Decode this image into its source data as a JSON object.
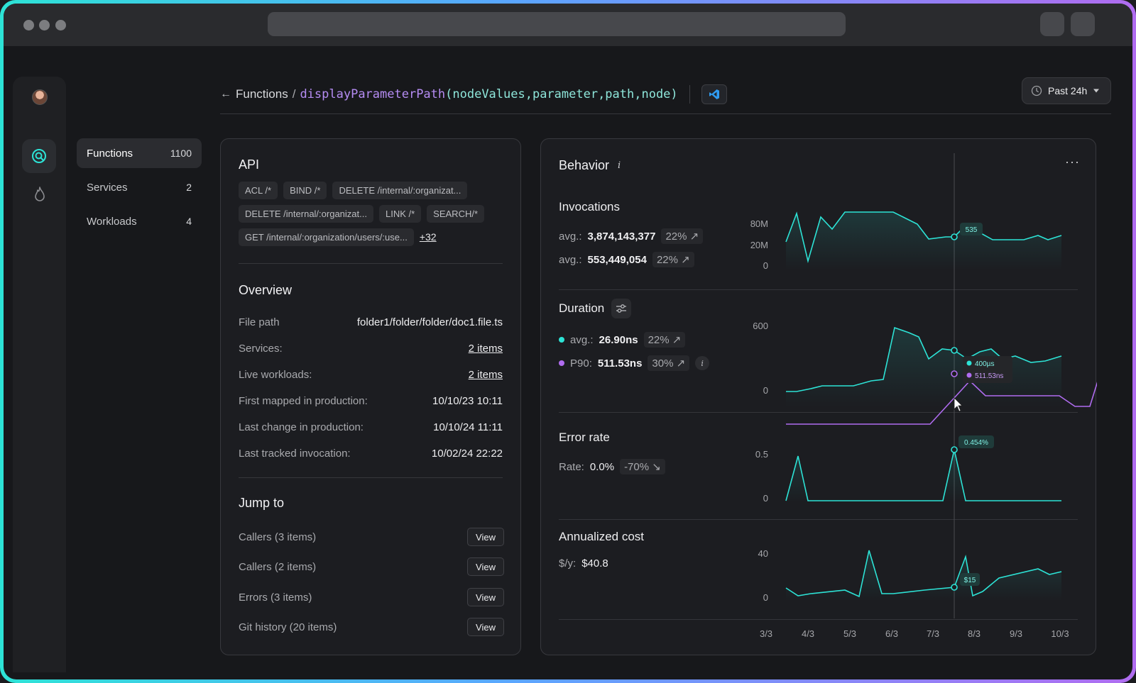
{
  "breadcrumb": {
    "back": "←",
    "root": "Functions",
    "sep": "/",
    "fn_name": "displayParameterPath",
    "fn_args": "(nodeValues,parameter,path,node)"
  },
  "time_range": "Past 24h",
  "colors": {
    "accent_teal": "#2de3d6",
    "accent_purple": "#b06cf0"
  },
  "sidebar": {
    "items": [
      {
        "label": "Functions",
        "count": "1100"
      },
      {
        "label": "Services",
        "count": "2"
      },
      {
        "label": "Workloads",
        "count": "4"
      }
    ]
  },
  "api": {
    "title": "API",
    "chips": [
      "ACL /*",
      "BIND /*",
      "DELETE /internal/:organizat...",
      "DELETE /internal/:organizat...",
      "LINK /*",
      "SEARCH/*",
      "GET /internal/:organization/users/:use..."
    ],
    "more": "+32"
  },
  "overview": {
    "title": "Overview",
    "rows": [
      {
        "k": "File path",
        "v": "folder1/folder/folder/doc1.file.ts"
      },
      {
        "k": "Services:",
        "v": "2 items"
      },
      {
        "k": "Live workloads:",
        "v": "2 items"
      },
      {
        "k": "First mapped in production:",
        "v": "10/10/23 10:11"
      },
      {
        "k": "Last change in production:",
        "v": "10/10/24 11:11"
      },
      {
        "k": "Last tracked invocation:",
        "v": "10/02/24 22:22"
      }
    ]
  },
  "jump": {
    "title": "Jump to",
    "view_label": "View",
    "items": [
      "Callers (3 items)",
      "Callers (2 items)",
      "Errors (3 items)",
      "Git history (20 items)"
    ]
  },
  "behavior": {
    "title": "Behavior",
    "info": "i",
    "menu": "···",
    "x_labels": [
      "3/3",
      "4/3",
      "5/3",
      "6/3",
      "7/3",
      "8/3",
      "9/3",
      "10/3"
    ],
    "invocations": {
      "title": "Invocations",
      "rows": [
        {
          "label": "avg.:",
          "value": "3,874,143,377",
          "delta": "22% ↗"
        },
        {
          "label": "avg.:",
          "value": "553,449,054",
          "delta": "22% ↗"
        }
      ],
      "y_ticks": [
        "80M",
        "20M",
        "0"
      ],
      "tooltip": "535"
    },
    "duration": {
      "title": "Duration",
      "rows": [
        {
          "label": "avg.:",
          "value": "26.90ns",
          "delta": "22% ↗"
        },
        {
          "label": "P90:",
          "value": "511.53ns",
          "delta": "30% ↗"
        }
      ],
      "info": "i",
      "y_ticks": [
        "600",
        "0"
      ],
      "tooltip_a": "400µs",
      "tooltip_b": "511.53ns"
    },
    "error_rate": {
      "title": "Error rate",
      "label": "Rate:",
      "value": "0.0%",
      "delta": "-70% ↘",
      "y_ticks": [
        "0.5",
        "0"
      ],
      "tooltip": "0.454%"
    },
    "cost": {
      "title": "Annualized cost",
      "label": "$/y:",
      "value": "$40.8",
      "y_ticks": [
        "40",
        "0"
      ],
      "tooltip": "$15"
    }
  }
}
